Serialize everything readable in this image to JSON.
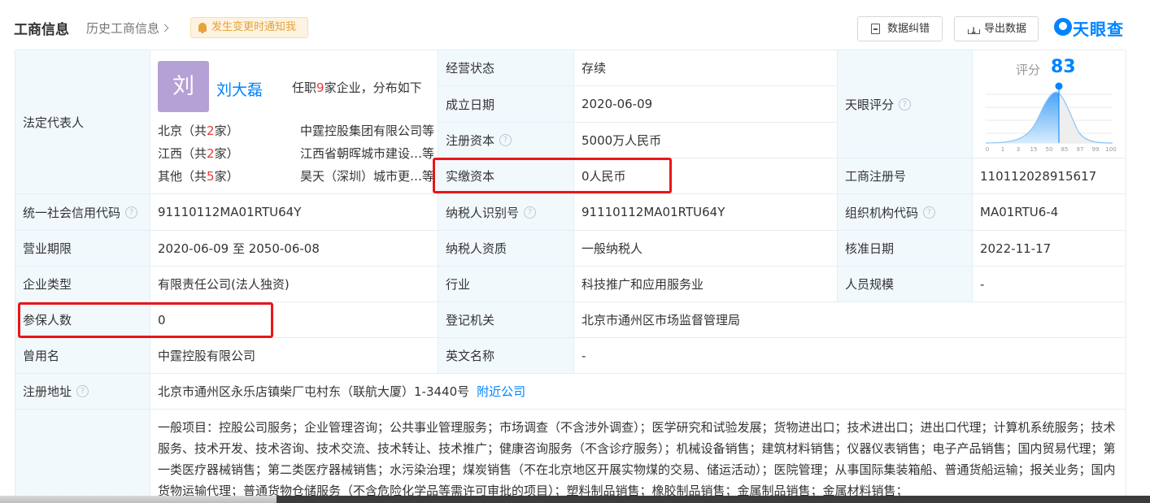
{
  "header": {
    "title": "工商信息",
    "history_link": "历史工商信息",
    "notify_label": "发生变更时通知我",
    "correct_button": "数据纠错",
    "export_button": "导出数据",
    "logo_text": "天眼查"
  },
  "legal_rep": {
    "label": "法定代表人",
    "avatar_char": "刘",
    "name": "刘大磊",
    "posts_pre": "任职",
    "posts_count": "9",
    "posts_post": "家企业，分布如下",
    "regions": [
      {
        "region_pre": "北京（共",
        "count": "2",
        "region_post": "家）",
        "company": "中霆控股集团有限公司",
        "suffix": "等"
      },
      {
        "region_pre": "江西（共",
        "count": "2",
        "region_post": "家）",
        "company": "江西省朝晖城市建设…",
        "suffix": "等"
      },
      {
        "region_pre": "其他（共",
        "count": "5",
        "region_post": "家）",
        "company": "昊天（深圳）城市更…",
        "suffix": "等"
      }
    ]
  },
  "fields": {
    "status_label": "经营状态",
    "status_value": "存续",
    "founded_label": "成立日期",
    "founded_value": "2020-06-09",
    "reg_capital_label": "注册资本",
    "reg_capital_value": "5000万人民币",
    "paid_capital_label": "实缴资本",
    "paid_capital_value": "0人民币",
    "tianyan_score_label": "天眼评分",
    "biz_reg_no_label": "工商注册号",
    "biz_reg_no_value": "110112028915617",
    "credit_code_label": "统一社会信用代码",
    "credit_code_value": "91110112MA01RTU64Y",
    "taxpayer_id_label": "纳税人识别号",
    "taxpayer_id_value": "91110112MA01RTU64Y",
    "org_code_label": "组织机构代码",
    "org_code_value": "MA01RTU6-4",
    "term_label": "营业期限",
    "term_value": "2020-06-09 至 2050-06-08",
    "taxpayer_qual_label": "纳税人资质",
    "taxpayer_qual_value": "一般纳税人",
    "approval_date_label": "核准日期",
    "approval_date_value": "2022-11-17",
    "type_label": "企业类型",
    "type_value": "有限责任公司(法人独资)",
    "industry_label": "行业",
    "industry_value": "科技推广和应用服务业",
    "staff_size_label": "人员规模",
    "staff_size_value": "-",
    "insured_label": "参保人数",
    "insured_value": "0",
    "authority_label": "登记机关",
    "authority_value": "北京市通州区市场监督管理局",
    "former_name_label": "曾用名",
    "former_name_value": "中霆控股有限公司",
    "english_name_label": "英文名称",
    "english_name_value": "-",
    "address_label": "注册地址",
    "address_value": "北京市通州区永乐店镇柴厂屯村东（联航大厦）1-3440号",
    "nearby_link": "附近公司",
    "scope_value": "一般项目：控股公司服务；企业管理咨询；公共事业管理服务；市场调查（不含涉外调查）；医学研究和试验发展；货物进出口；技术进出口；进出口代理；计算机系统服务；技术服务、技术开发、技术咨询、技术交流、技术转让、技术推广；健康咨询服务（不含诊疗服务）；机械设备销售；建筑材料销售；仪器仪表销售；电子产品销售；国内贸易代理；第一类医疗器械销售；第二类医疗器械销售；水污染治理；煤炭销售（不在北京地区开展实物煤的交易、储运活动）；医院管理；从事国际集装箱船、普通货船运输；报关业务；国内货物运输代理；普通货物仓储服务（不含危险化学品等需许可审批的项目）；塑料制品销售；橡胶制品销售；金属制品销售；金属材料销售；"
  },
  "score": {
    "label": "评分",
    "value": 83,
    "axis_ticks": [
      "0",
      "1",
      "3",
      "15",
      "50",
      "85",
      "97",
      "99",
      "100"
    ]
  },
  "colors": {
    "accent": "#0084ff",
    "label_bg": "#f2f9fc",
    "highlight": "#e8161a",
    "notify_bg": "#fdf3e0"
  }
}
